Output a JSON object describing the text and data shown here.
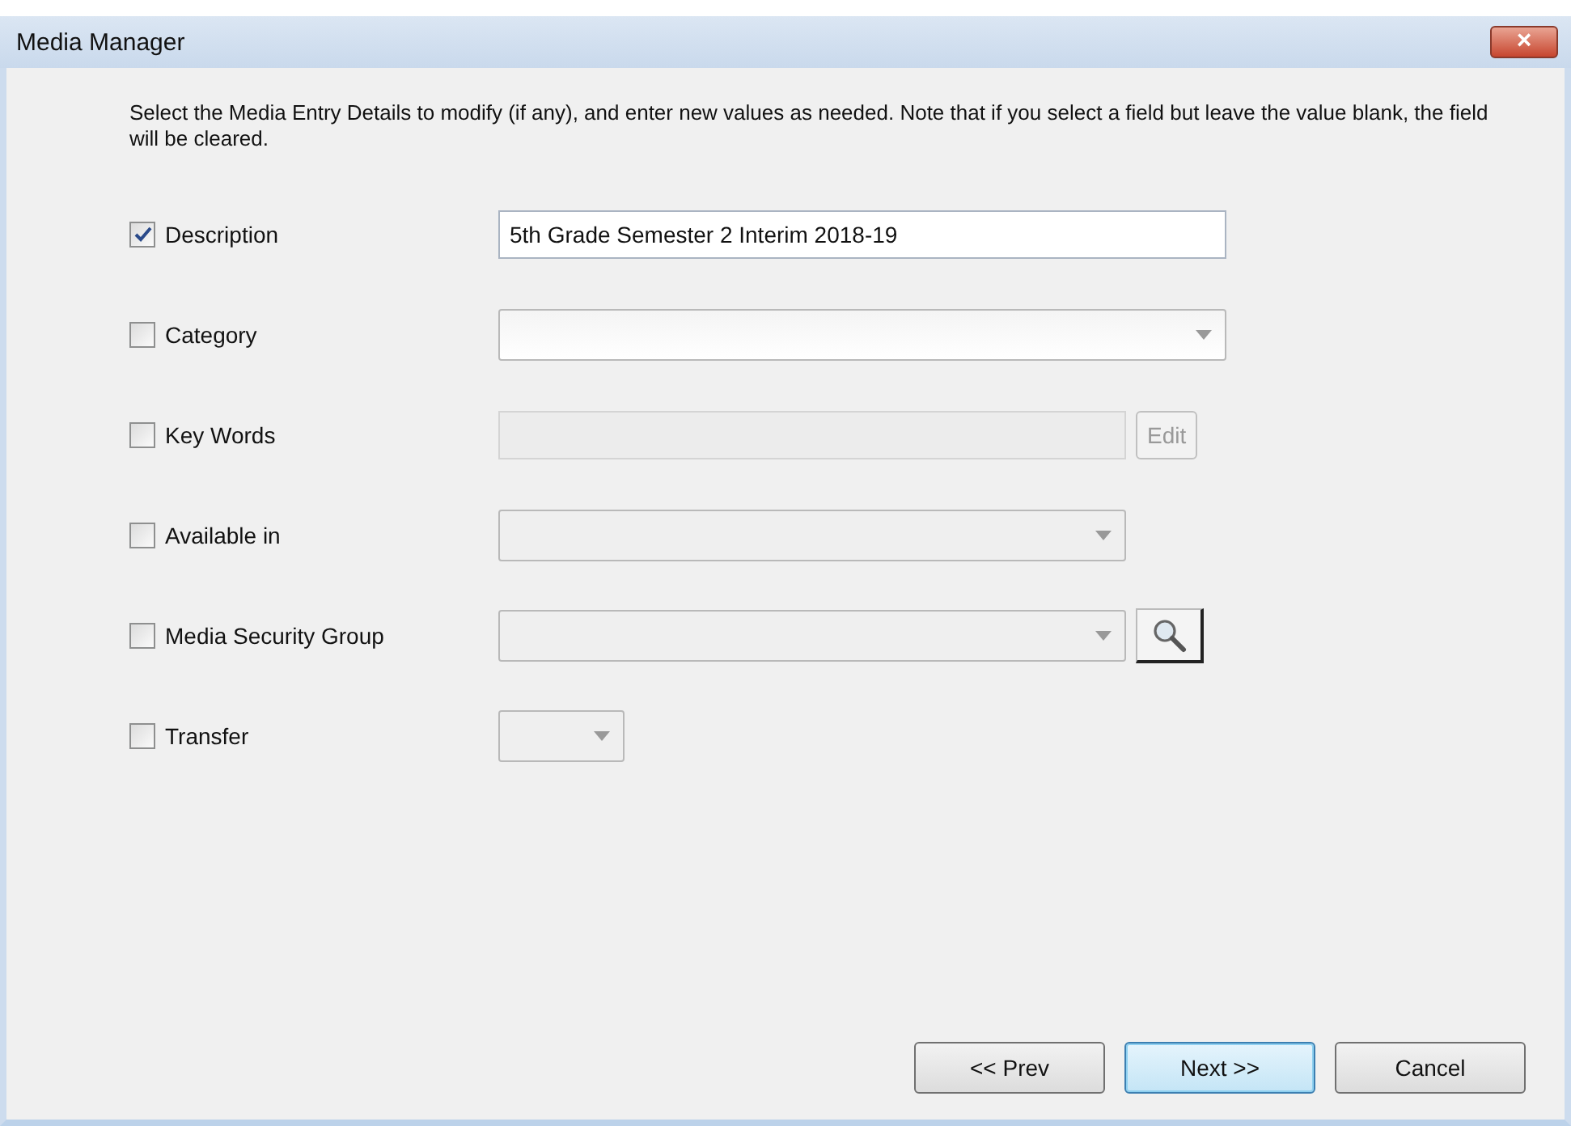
{
  "window": {
    "title": "Media Manager",
    "close": "×"
  },
  "instructions": "Select the Media Entry Details to modify (if any), and enter new values as needed.  Note that if you select a field but leave the value blank, the field will be cleared.",
  "fields": [
    {
      "label": "Description",
      "checked": true,
      "kind": "text",
      "value": "5th Grade Semester 2 Interim 2018-19",
      "disabled": false
    },
    {
      "label": "Category",
      "checked": false,
      "kind": "wide-combo",
      "disabled": false
    },
    {
      "label": "Key Words",
      "checked": false,
      "kind": "text-edit",
      "disabled": true,
      "button": {
        "label": "Edit",
        "disabled": true
      }
    },
    {
      "label": "Available in",
      "checked": false,
      "kind": "combo",
      "disabled": true
    },
    {
      "label": "Media Security Group",
      "checked": false,
      "kind": "combo-search",
      "disabled": true
    },
    {
      "label": "Transfer",
      "checked": false,
      "kind": "small-combo",
      "disabled": true
    }
  ],
  "buttons": [
    {
      "label": "<< Prev",
      "default": false
    },
    {
      "label": "Next >>",
      "default": true
    },
    {
      "label": "Cancel",
      "default": false
    }
  ]
}
